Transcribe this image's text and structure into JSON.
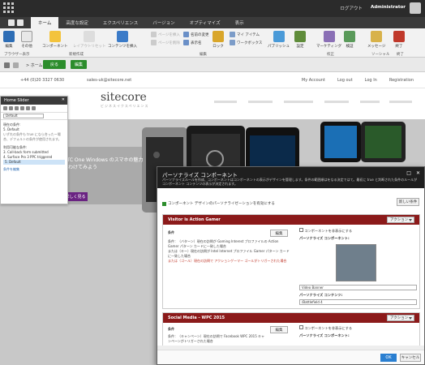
{
  "topbar": {
    "logout": "ログアウト",
    "user": "Administrator"
  },
  "tabs": [
    "ホーム",
    "高度な設定",
    "エクスペリエンス",
    "バージョン",
    "オプティマイズ",
    "表示"
  ],
  "ribbon": {
    "btn_save": "編集",
    "btn_other": "その他",
    "btn_component": "コンポーネント",
    "btn_layout": "レイアウトリセット",
    "grp_brows": "ブラウザー表示",
    "grp_edit": "新規作成",
    "btn_insert": "コンテンツを挿入",
    "btn_page": "ページを挿入",
    "btn_page2": "ページを削除",
    "btn_rename": "名前の変更",
    "btn_display": "表示名",
    "btn_lock": "ロック",
    "btn_myitems": "マイ アイテム",
    "btn_workbox": "ワークボックス",
    "grp_edit2": "編集",
    "btn_publish": "パブリッシュ",
    "btn_settings": "設定",
    "btn_marketing": "マーケティング",
    "btn_verify": "検証",
    "grp_proof": "校正",
    "btn_message": "メッセージ",
    "btn_close": "終了",
    "grp_social": "ソーシャル",
    "grp_end": "終了"
  },
  "nav": {
    "crumb": "> ホーム >",
    "btn_back": "戻る",
    "btn_edit": "編集"
  },
  "site": {
    "phone": "+44 (0)20 3327 0630",
    "email": "sales-uk@sitecore.net",
    "links": [
      "My Account",
      "Log out",
      "Log In",
      "Registration"
    ],
    "logo": "sitecore",
    "tagline": "ビジネスイクスペリエンス"
  },
  "hero": {
    "text": "HTC One Windows のスマホの魅力をわけてみよう",
    "button": "詳しく見る"
  },
  "panel": {
    "title": "Home Slider",
    "select": "Default",
    "current_label": "現在の条件:",
    "current_value": "5. Default",
    "current_desc": "いずれの条件も true になら合ったー場合、デフォルトの条件が使用されます。",
    "available_label": "利用可能な条件:",
    "items": [
      "3. Call-back form submitted",
      "4. Surface Pro 3 PPC triggered",
      "5. Default"
    ],
    "add": "条件を編集"
  },
  "dialog": {
    "title": "パーソナライズ コンポーネント",
    "desc": "パーソナライズルールを作成、コンポーネントはコンポーネントの表示がデザインを管理します。条件の範囲順はをなる決定ではて。最初に true と判断された条件のルールがコンポーネント コンテンツの表示が決定されます。",
    "checkbox": "コンポーネント デザインのパーソナライゼーションを有効にする",
    "add_btn": "新しい条件",
    "rule1": {
      "title": "Visitor is Action Gamer",
      "actions": "アクション",
      "cond_label": "条件",
      "cond": "条件：（バターン）現在の訪問が Gaming Interest プロファイルの Action Gamer パターン カードに一致した場合",
      "cond2": "または（キー）現在の訪問が Intel Internet プロファイル Gamer パターン カードに一致した場合",
      "cond3": "または（ゴール）現在の訪問で アクションゲーマー ゴールがトリガーされた場合",
      "edit": "編集",
      "hide": "コンポーネントを非表示にする",
      "pc_label": "パーソナライズ コンポーネント:",
      "pc_value": "Video Banner",
      "pcc_label": "パーソナライズ コンテンツ:",
      "pcc_value": "/Battlefield 4"
    },
    "rule2": {
      "title": "Social Media – WPC 2015",
      "actions": "アクション",
      "cond_label": "条件",
      "cond": "条件：（キャンペーン）現在の訪問で Facebook WPC 2015 キャンペーンがトリガーされた場合",
      "edit": "編集",
      "hide": "コンポーネントを非表示にする",
      "pc_label": "パーソナライズ コンポーネント:"
    },
    "ok": "OK",
    "cancel": "キャンセル"
  }
}
